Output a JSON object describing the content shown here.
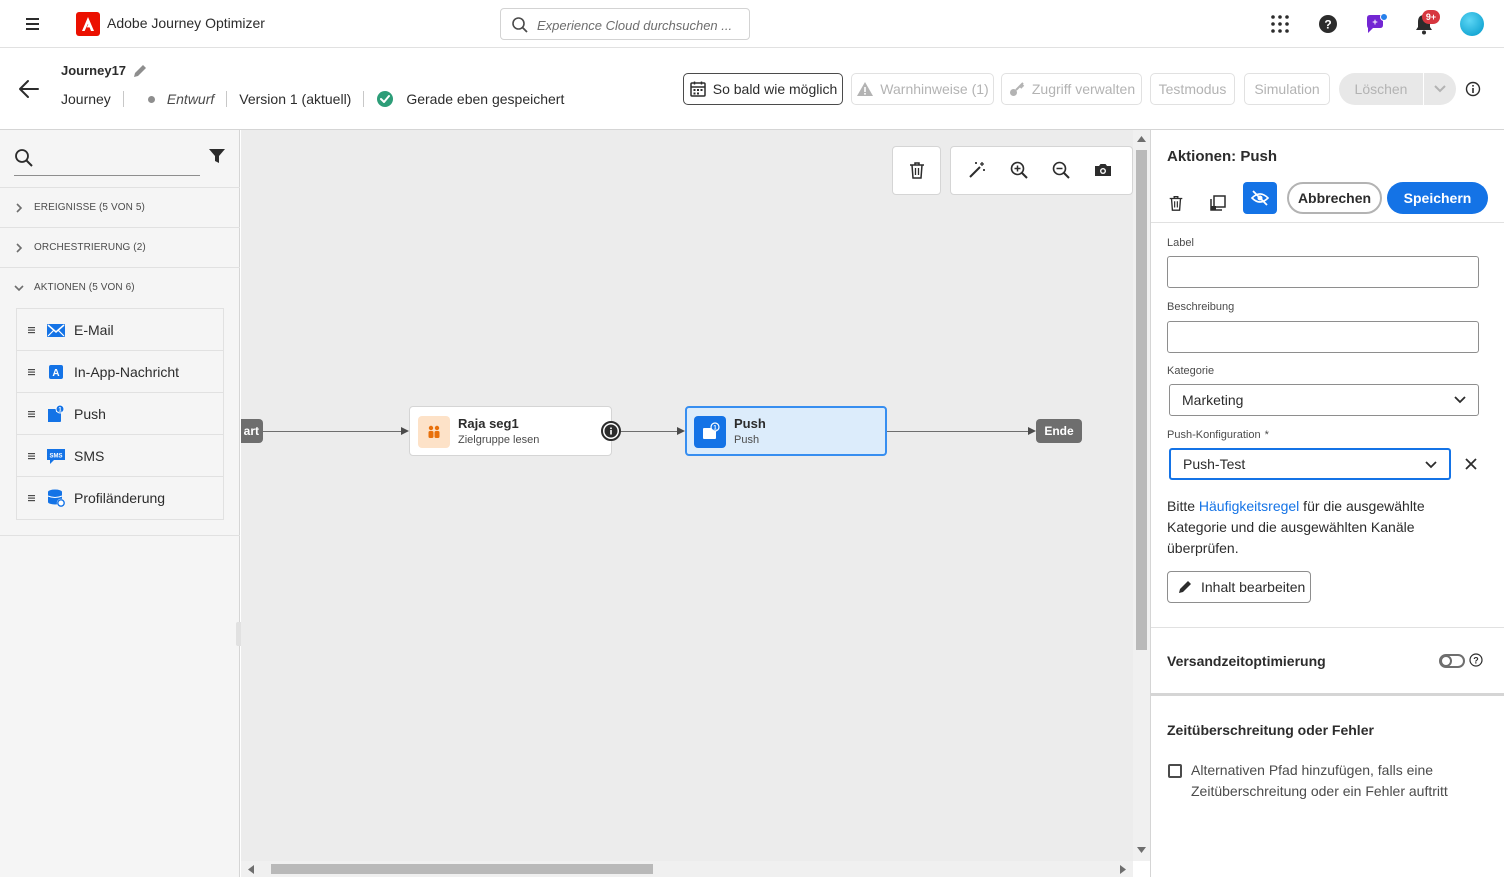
{
  "topbar": {
    "app_title": "Adobe Journey Optimizer",
    "search_placeholder": "Experience Cloud durchsuchen ...",
    "notification_count": "9+",
    "icons": [
      "menu-icon",
      "adobe-logo-icon",
      "search-icon",
      "apps-grid-icon",
      "help-icon",
      "feedback-icon",
      "bell-icon",
      "avatar"
    ]
  },
  "journey": {
    "name": "Journey17",
    "type": "Journey",
    "status": "Entwurf",
    "version": "Version 1 (aktuell)",
    "saved_status": "Gerade eben gespeichert",
    "buttons": {
      "schedule": "So bald wie möglich",
      "warnings": "Warnhinweise (1)",
      "access": "Zugriff verwalten",
      "test_mode": "Testmodus",
      "simulation": "Simulation",
      "delete": "Löschen"
    }
  },
  "palette": {
    "categories": [
      {
        "label": "EREIGNISSE (5 VON 5)"
      },
      {
        "label": "ORCHESTRIERUNG (2)"
      },
      {
        "label": "AKTIONEN (5 VON 6)"
      }
    ],
    "actions": [
      {
        "label": "E-Mail",
        "icon": "email-icon"
      },
      {
        "label": "In-App-Nachricht",
        "icon": "in-app-icon"
      },
      {
        "label": "Push",
        "icon": "push-icon"
      },
      {
        "label": "SMS",
        "icon": "sms-icon"
      },
      {
        "label": "Profiländerung",
        "icon": "profile-update-icon"
      }
    ]
  },
  "canvas": {
    "start_label": "art",
    "end_label": "Ende",
    "nodes": [
      {
        "title": "Raja seg1",
        "subtitle": "Zielgruppe lesen",
        "icon": "audience-icon"
      },
      {
        "title": "Push",
        "subtitle": "Push",
        "icon": "push-icon",
        "selected": true
      }
    ],
    "toolbar_icons": [
      "trash-icon",
      "magic-wand-icon",
      "zoom-in-icon",
      "zoom-out-icon",
      "camera-icon"
    ]
  },
  "panel": {
    "title": "Aktionen: Push",
    "cancel": "Abbrechen",
    "save": "Speichern",
    "label_field": {
      "label": "Label",
      "value": ""
    },
    "description_field": {
      "label": "Beschreibung",
      "value": ""
    },
    "category": {
      "label": "Kategorie",
      "value": "Marketing"
    },
    "push_config": {
      "label": "Push-Konfiguration",
      "required_mark": "*",
      "value": "Push-Test"
    },
    "note_prefix": "Bitte ",
    "note_link": "Häufigkeitsregel",
    "note_suffix": " für die ausgewählte Kategorie und die ausgewählten Kanäle überprüfen.",
    "edit_content": "Inhalt bearbeiten",
    "send_time_optimization": "Versandzeitoptimierung",
    "send_time_optimization_on": false,
    "timeout_section": "Zeitüberschreitung oder Fehler",
    "timeout_checkbox": "Alternativen Pfad hinzufügen, falls eine Zeitüberschreitung oder ein Fehler auftritt",
    "timeout_checked": false
  }
}
